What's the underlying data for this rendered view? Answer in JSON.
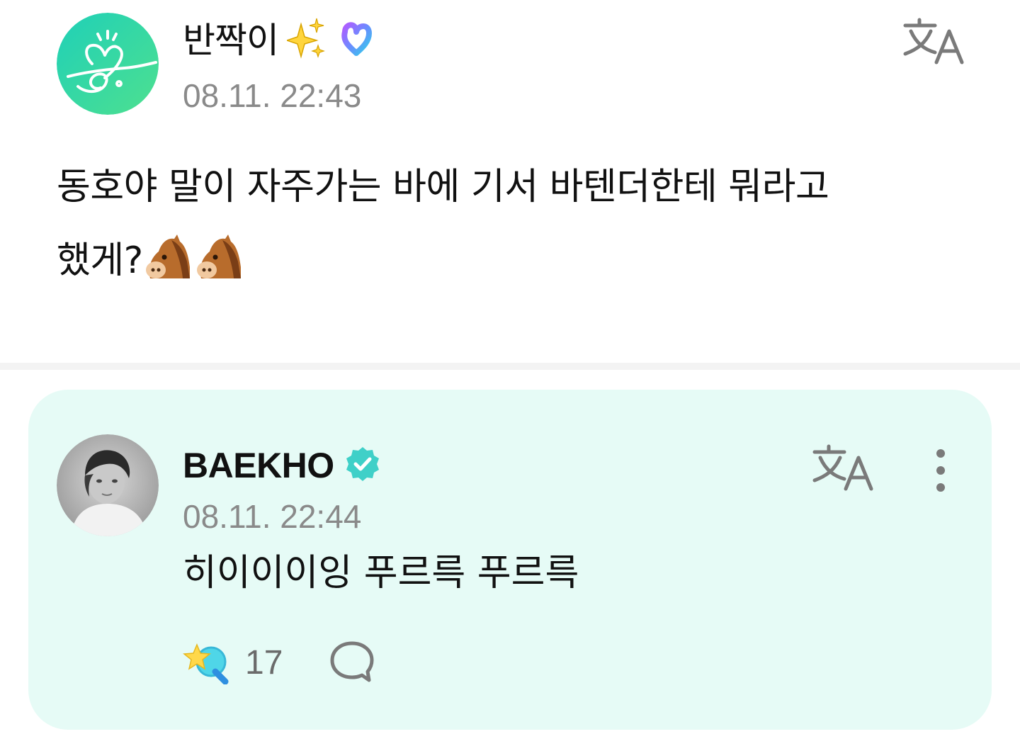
{
  "post": {
    "author": "반짝이",
    "author_badge_icon": "sparkles-icon",
    "membership_icon": "membership-heart-icon",
    "timestamp": "08.11. 22:43",
    "body_line1": "동호야 말이 자주가는 바에 기서 바텐더한테 뭐라고",
    "body_line2": "했게?",
    "body_emojis": [
      "horse-face-icon",
      "horse-face-icon"
    ],
    "translate_icon": "translate-icon"
  },
  "reply": {
    "author": "BAEKHO",
    "verified_icon": "verified-check-icon",
    "timestamp": "08.11. 22:44",
    "text": "히이이이잉 푸르륵 푸르륵",
    "translate_icon": "translate-icon",
    "more_icon": "more-vertical-icon",
    "like_icon": "like-star-icon",
    "like_count": "17",
    "comment_icon": "comment-bubble-icon"
  },
  "colors": {
    "card_background": "#e6fbf6",
    "fan_avatar": "#2fd6b0",
    "verified": "#3fd0c8",
    "timestamp": "#8a8a8a",
    "icon_gray": "#7a7a7a"
  }
}
